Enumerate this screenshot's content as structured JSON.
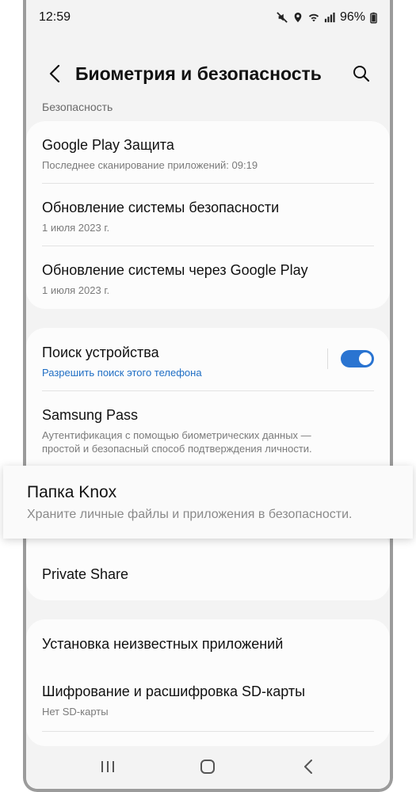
{
  "status_bar": {
    "time": "12:59",
    "battery": "96%",
    "icons": [
      "mute-icon",
      "location-icon",
      "wifi-icon",
      "signal-icon"
    ]
  },
  "app_bar": {
    "title": "Биометрия и безопасность",
    "back_icon": "back-chevron-icon",
    "search_icon": "search-icon"
  },
  "section": {
    "header": "Безопасность"
  },
  "card1": {
    "items": [
      {
        "title": "Google Play Защита",
        "subtitle": "Последнее сканирование приложений: 09:19"
      },
      {
        "title": "Обновление системы безопасности",
        "subtitle": "1 июля 2023 г."
      },
      {
        "title": "Обновление системы через Google Play",
        "subtitle": "1 июля 2023 г."
      }
    ]
  },
  "card2": {
    "find_device": {
      "title": "Поиск устройства",
      "subtitle": "Разрешить поиск этого телефона",
      "enabled": true
    },
    "samsung_pass": {
      "title": "Samsung Pass",
      "subtitle_line1": "Аутентификация с помощью биометрических данных —",
      "subtitle_line2": "простой и безопасный способ подтверждения личности."
    }
  },
  "highlight": {
    "title": "Папка Knox",
    "subtitle": "Храните личные файлы и приложения в безопасности."
  },
  "card3": {
    "title": "Private Share"
  },
  "card4": {
    "items": [
      {
        "title": "Установка неизвестных приложений",
        "subtitle": ""
      },
      {
        "title": "Шифрование и расшифровка SD-карты",
        "subtitle": "Нет SD-карты"
      }
    ]
  },
  "nav_bar": {
    "icons": [
      "recents-icon",
      "home-icon",
      "back-icon"
    ]
  },
  "colors": {
    "accent": "#2a74d1",
    "link": "#1f6ec4",
    "background": "#f3f3f3",
    "card": "#fcfcfc"
  }
}
